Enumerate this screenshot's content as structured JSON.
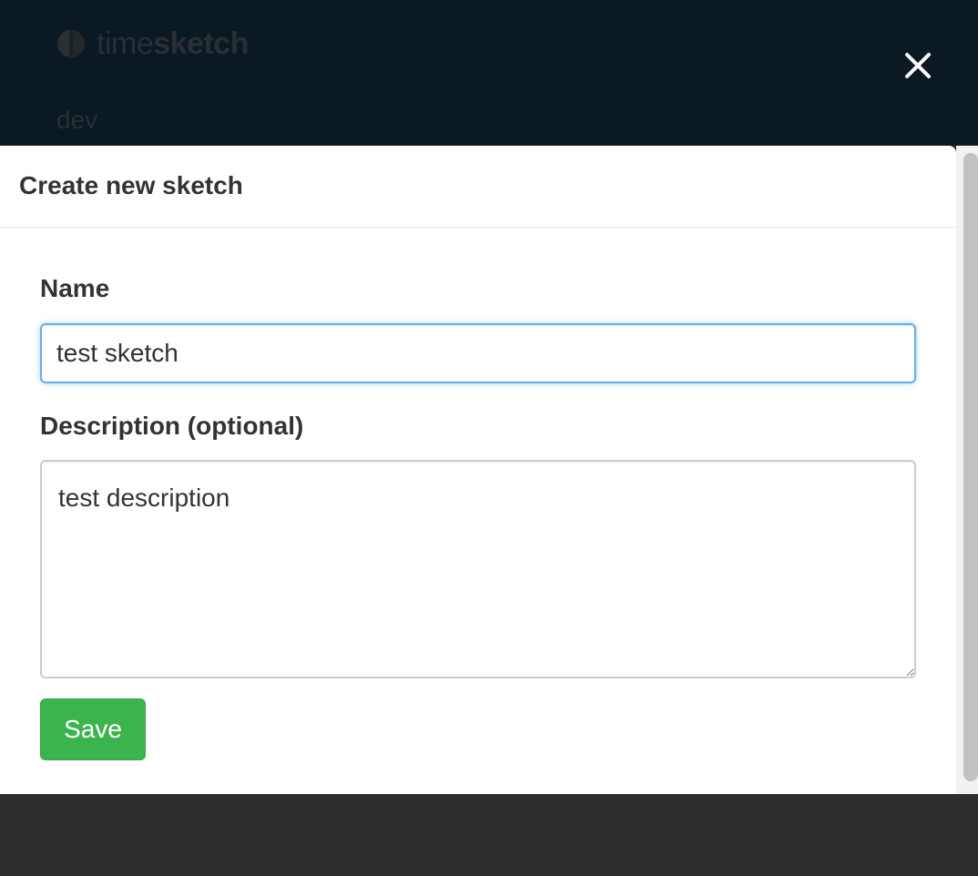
{
  "app": {
    "brand_light": "time",
    "brand_bold": "sketch",
    "subtitle": "dev"
  },
  "modal": {
    "title": "Create new sketch",
    "name_label": "Name",
    "name_value": "test sketch",
    "description_label": "Description (optional)",
    "description_value": "test description",
    "save_label": "Save"
  },
  "icons": {
    "logo": "timesketch-logo-icon",
    "close": "close-icon"
  },
  "colors": {
    "header_bg": "#0b1923",
    "save_button": "#3cb44e",
    "focus_border": "#66afe9"
  }
}
